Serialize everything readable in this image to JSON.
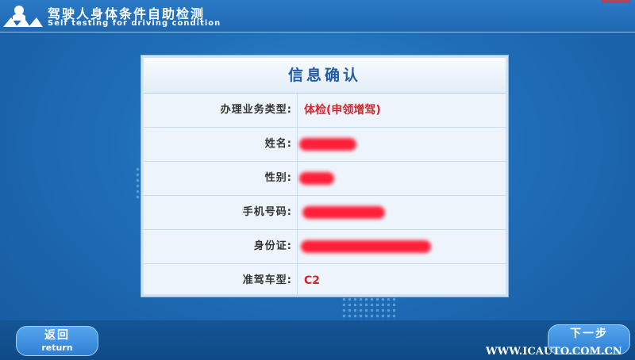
{
  "header": {
    "title": "驾驶人身体条件自助检测",
    "subtitle": "Self testing for driving condition"
  },
  "panel": {
    "title": "信息确认",
    "rows": [
      {
        "label": "办理业务类型:",
        "value": "体检(申领增驾)"
      },
      {
        "label": "姓名:",
        "value": ""
      },
      {
        "label": "性别:",
        "value": ""
      },
      {
        "label": "手机号码:",
        "value": ""
      },
      {
        "label": "身份证:",
        "value": ""
      },
      {
        "label": "准驾车型:",
        "value": "C2"
      }
    ]
  },
  "footer": {
    "return_zh": "返回",
    "return_en": "return",
    "next_zh": "下一步"
  },
  "watermark": "WWW.ICAUTO.COM.CN",
  "colors": {
    "accent": "#1f5ca8",
    "value": "#d2252d",
    "redaction": "#ff1f3a"
  }
}
